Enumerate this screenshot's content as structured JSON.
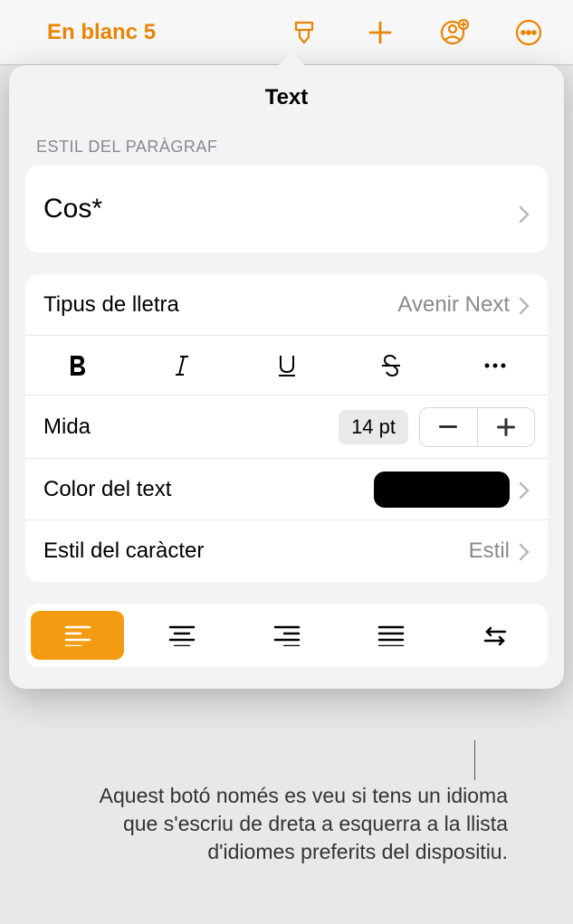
{
  "toolbar": {
    "doc_title": "En blanc 5"
  },
  "popover": {
    "title": "Text",
    "paragraph_style_label": "ESTIL DEL PARÀGRAF",
    "paragraph_style_value": "Cos*",
    "font_label": "Tipus de lletra",
    "font_value": "Avenir Next",
    "size_label": "Mida",
    "size_value": "14 pt",
    "text_color_label": "Color del text",
    "text_color_value": "#000000",
    "char_style_label": "Estil del caràcter",
    "char_style_value": "Estil"
  },
  "annotation": {
    "text": "Aquest botó només es veu si tens un idioma que s'escriu de dreta a esquerra a la llista d'idiomes preferits del dispositiu."
  },
  "colors": {
    "accent": "#e88504",
    "active_align": "#f39c12"
  }
}
